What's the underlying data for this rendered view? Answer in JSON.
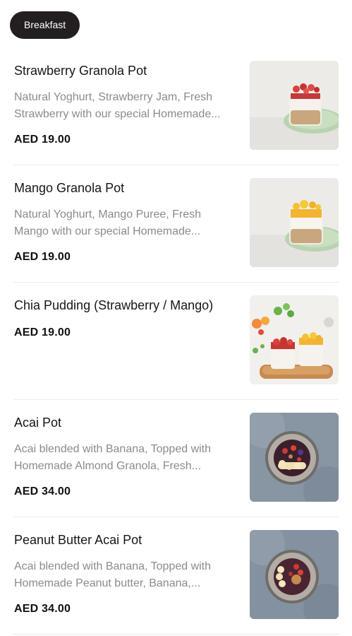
{
  "category_chip": "Breakfast",
  "items": [
    {
      "title": "Strawberry Granola Pot",
      "desc_lines": [
        "Natural Yoghurt, Strawberry Jam, Fresh",
        "Strawberry with our special Homemade..."
      ],
      "price": "AED 19.00",
      "image": "strawberry-granola-pot-photo"
    },
    {
      "title": "Mango Granola Pot",
      "desc_lines": [
        "Natural Yoghurt, Mango Puree, Fresh",
        "Mango with our special Homemade..."
      ],
      "price": "AED 19.00",
      "image": "mango-granola-pot-photo"
    },
    {
      "title": "Chia Pudding (Strawberry / Mango)",
      "desc_lines": [],
      "price": "AED 19.00",
      "image": "chia-pudding-photo"
    },
    {
      "title": "Acai Pot",
      "desc_lines": [
        "Acai blended with Banana, Topped with",
        "Homemade Almond Granola, Fresh..."
      ],
      "price": "AED 34.00",
      "image": "acai-pot-photo"
    },
    {
      "title": "Peanut Butter Acai Pot",
      "desc_lines": [
        "Acai blended with Banana, Topped with",
        "Homemade Peanut butter, Banana,..."
      ],
      "price": "AED 34.00",
      "image": "peanut-butter-acai-pot-photo"
    }
  ]
}
